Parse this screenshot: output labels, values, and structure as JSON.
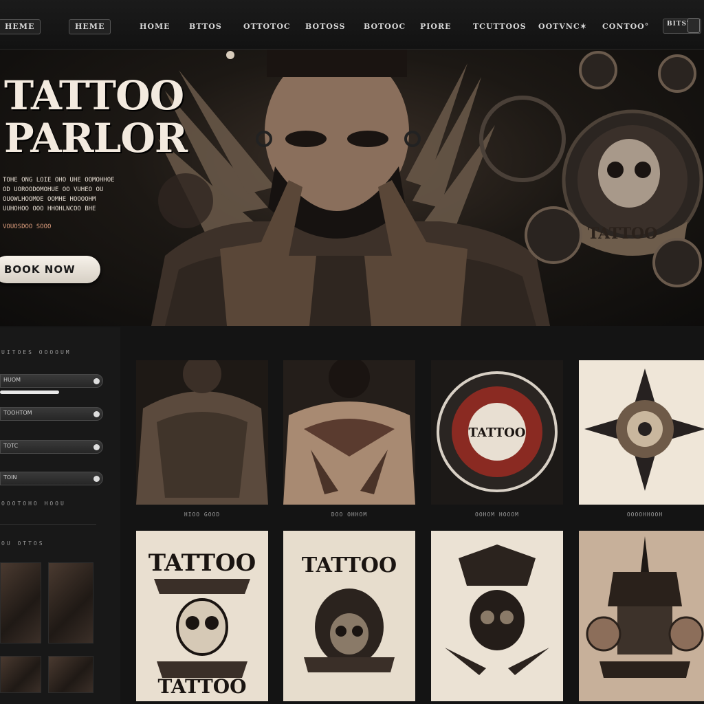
{
  "nav": {
    "logo": "HEME",
    "items": [
      "HEME",
      "HOME",
      "BTTOS",
      "OTTOTOC",
      "BOTOSS",
      "BOTOOC",
      "PIORE",
      "TCUTTOOS",
      "OOTVNC✶",
      "CONTOO°"
    ],
    "small_button": "BITSTY"
  },
  "hero": {
    "title": "TATTOO\nPARLOR",
    "text": "TOHE ONG LOIE OHO UHE OOMOHHOE\nOD UOROODOMOHUE OO VUHEO OU\nOUOWLHOOMOE OOMHE HOOOOHM\nUUHOHOO OOO HHOHLNCOO BHE",
    "badge": "VOUOSDOO  SOOO",
    "book_button": "BOOK NOW",
    "art_label": "TATTOO"
  },
  "sidebar": {
    "heading1": "UITOES OOOOUM",
    "fields": [
      "HUOM",
      "TOOHTOM",
      "TOTC",
      "TOIN"
    ],
    "heading2": "OOOTOHO HOOU",
    "heading3": "OU OTTOS"
  },
  "gallery": {
    "captions": [
      "HIOO GOOD",
      "DOO OHHOM",
      "OOHOM HOOOM",
      "OOOOHHOOH"
    ],
    "badge_text": "TATTOO",
    "posters": [
      {
        "top": "TATTOO",
        "bottom": "TATTOO"
      },
      {
        "top": "TATTOO",
        "bottom": ""
      },
      {
        "top": "",
        "bottom": ""
      },
      {
        "top": "",
        "bottom": ""
      }
    ]
  },
  "colors": {
    "bg": "#141414",
    "accent": "#f3eadf",
    "button": "#f7f2ea"
  }
}
